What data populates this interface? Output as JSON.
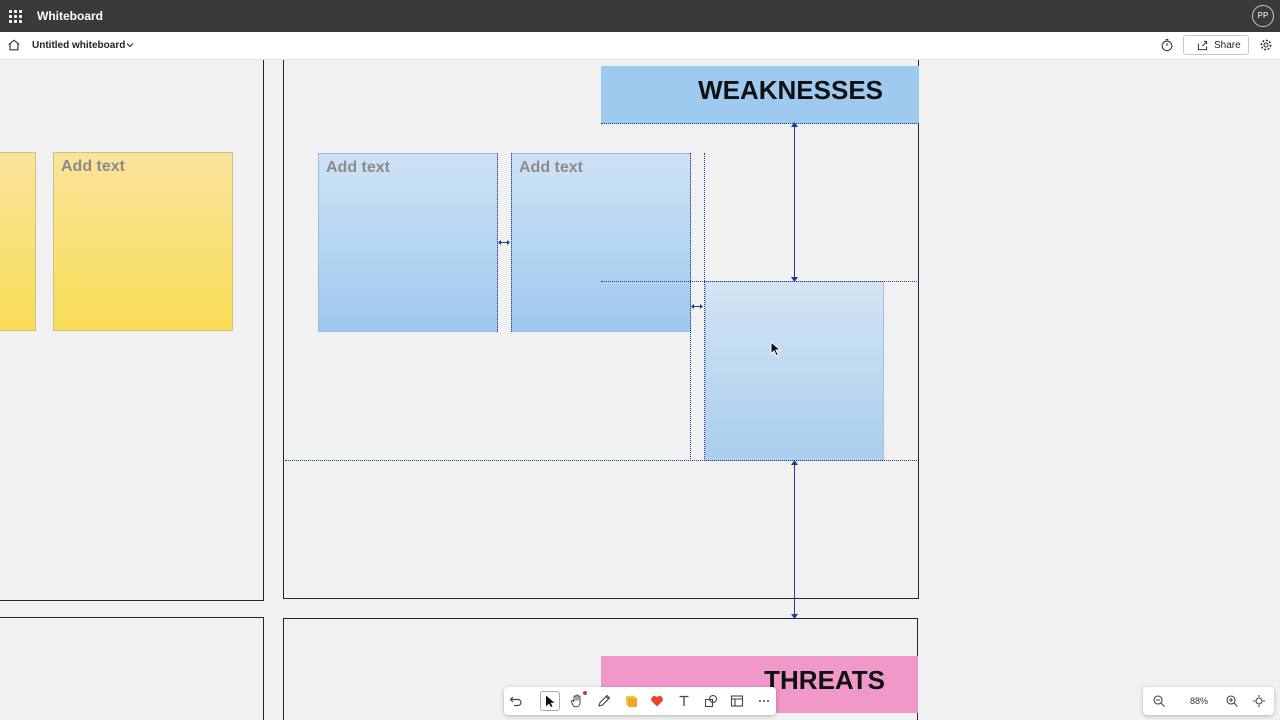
{
  "app": {
    "title": "Whiteboard",
    "user_initials": "PP"
  },
  "file": {
    "name": "Untitled whiteboard"
  },
  "header_actions": {
    "share_label": "Share"
  },
  "icons": [
    "app-launcher-icon",
    "home-icon",
    "chevron-down-icon",
    "timer-icon",
    "share-icon",
    "settings-icon",
    "undo-icon",
    "select-icon",
    "hand-icon",
    "pen-icon",
    "sticky-note-icon",
    "reaction-icon",
    "text-icon",
    "shapes-icon",
    "templates-icon",
    "more-icon",
    "zoom-out-icon",
    "zoom-in-icon",
    "fit-to-screen-icon"
  ],
  "canvas": {
    "sections": [
      {
        "title": "WEAKNESSES",
        "color": "#9ecaf0"
      },
      {
        "title": "THREATS",
        "color": "#f098c8"
      }
    ],
    "sticky_notes": [
      {
        "color": "yellow",
        "placeholder": ""
      },
      {
        "color": "yellow",
        "placeholder": "Add text"
      },
      {
        "color": "blue",
        "placeholder": "Add text"
      },
      {
        "color": "blue",
        "placeholder": "Add text"
      },
      {
        "color": "blue",
        "placeholder": ""
      }
    ]
  },
  "zoom": {
    "level": "88%"
  },
  "colors": {
    "app_bar": "#3b3a39",
    "canvas": "#f1f1f1",
    "guide": "#1f3a93",
    "sticky_yellow": "#f8dd55",
    "sticky_blue": "#9ec9ee"
  }
}
